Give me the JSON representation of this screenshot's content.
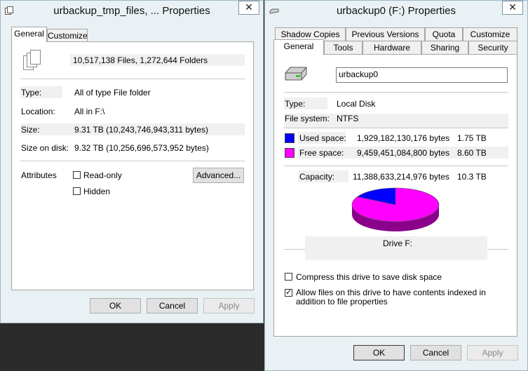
{
  "left_window": {
    "title": "urbackup_tmp_files, ... Properties",
    "close_glyph": "✕",
    "tabs": [
      {
        "label": "General",
        "active": true
      },
      {
        "label": "Customize",
        "active": false
      }
    ],
    "file_count": "10,517,138 Files, 1,272,644 Folders",
    "rows": [
      {
        "label": "Type:",
        "value": "All of type File folder"
      },
      {
        "label": "Location:",
        "value": "All in F:\\"
      },
      {
        "label": "Size:",
        "value": "9.31 TB (10,243,746,943,311 bytes)"
      },
      {
        "label": "Size on disk:",
        "value": "9.32 TB (10,256,696,573,952 bytes)"
      }
    ],
    "attributes_label": "Attributes",
    "read_only_label": "Read-only",
    "hidden_label": "Hidden",
    "advanced_label": "Advanced...",
    "ok_label": "OK",
    "cancel_label": "Cancel",
    "apply_label": "Apply"
  },
  "right_window": {
    "title": "urbackup0 (F:) Properties",
    "close_glyph": "✕",
    "tabs_top": [
      "Shadow Copies",
      "Previous Versions",
      "Quota",
      "Customize"
    ],
    "tabs_bottom": [
      "General",
      "Tools",
      "Hardware",
      "Sharing",
      "Security"
    ],
    "active_tab": "General",
    "drive_name": "urbackup0",
    "type_label": "Type:",
    "type_value": "Local Disk",
    "fs_label": "File system:",
    "fs_value": "NTFS",
    "used_label": "Used space:",
    "used_bytes": "1,929,182,130,176 bytes",
    "used_size": "1.75 TB",
    "free_label": "Free space:",
    "free_bytes": "9,459,451,084,800 bytes",
    "free_size": "8.60 TB",
    "capacity_label": "Capacity:",
    "capacity_bytes": "11,388,633,214,976 bytes",
    "capacity_size": "10.3 TB",
    "used_fraction": 0.1694,
    "drive_label": "Drive F:",
    "compress_label": "Compress this drive to save disk space",
    "index_label": "Allow files on this drive to have contents indexed in addition to file properties",
    "compress_checked": false,
    "index_checked": true,
    "ok_label": "OK",
    "cancel_label": "Cancel",
    "apply_label": "Apply"
  },
  "colors": {
    "used": "#0000ff",
    "free": "#ff00ff",
    "used_dark": "#00008b",
    "free_dark": "#8b008b"
  },
  "icons": {
    "left_title_icon": "files-icon",
    "right_title_icon": "drive-icon"
  }
}
